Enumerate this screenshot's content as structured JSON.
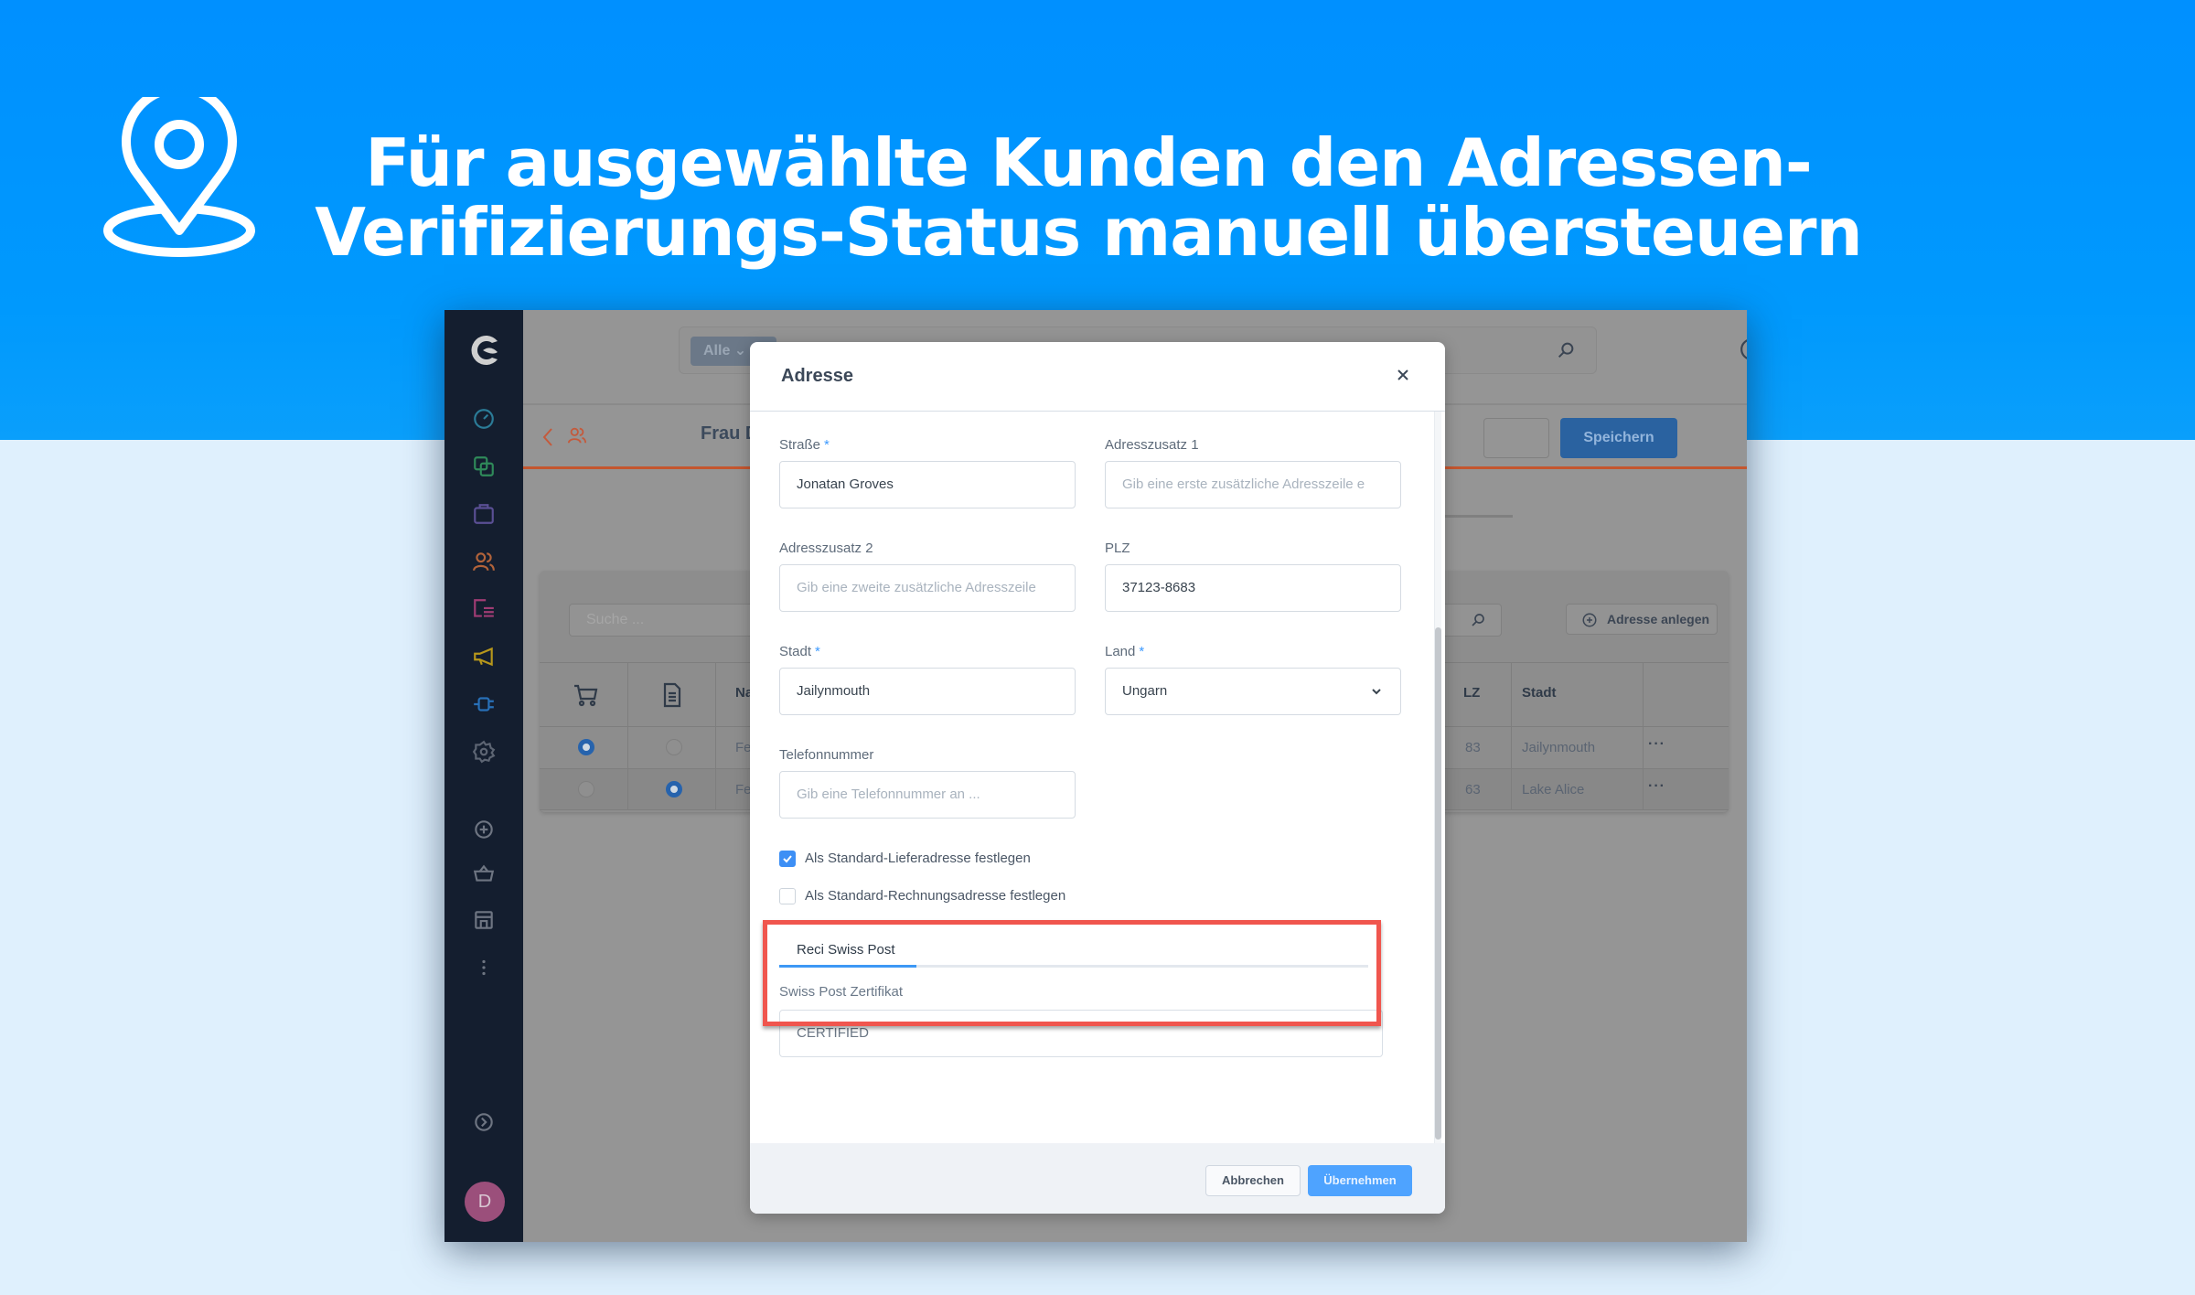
{
  "hero": {
    "title_line1": "Für ausgewählte Kunden den Adressen-",
    "title_line2": "Verifizierungs-Status manuell übersteuern",
    "icon": "location-pin-icon",
    "band_color": "#0093ff"
  },
  "app": {
    "logo": "shopware-logo",
    "sidebar": {
      "items": [
        {
          "icon": "dashboard-gauge-icon",
          "color": "#2b7c98"
        },
        {
          "icon": "catalog-layers-icon",
          "color": "#2f8a5a"
        },
        {
          "icon": "orders-bag-icon",
          "color": "#5a4f94"
        },
        {
          "icon": "customers-icon",
          "color": "#b2633a"
        },
        {
          "icon": "content-icon",
          "color": "#a03c74"
        },
        {
          "icon": "marketing-megaphone-icon",
          "color": "#b7971b"
        },
        {
          "icon": "extensions-plug-icon",
          "color": "#2870b8"
        },
        {
          "icon": "settings-gear-icon",
          "color": "#5d6573"
        }
      ],
      "bottom_items": [
        {
          "icon": "add-circle-icon"
        },
        {
          "icon": "basket-icon"
        },
        {
          "icon": "storefront-icon"
        },
        {
          "icon": "more-vertical-icon"
        }
      ],
      "expand_icon": "expand-chevron-icon",
      "avatar_initial": "D"
    },
    "topbar": {
      "search_scope": "Alle",
      "search_placeholder": ""
    },
    "pagehead": {
      "customer_name": "Frau Dr. r",
      "save_label": "Speichern"
    },
    "addresses": {
      "search_placeholder": "Suche ...",
      "add_label": "Adresse anlegen",
      "columns": [
        "",
        "",
        "Na",
        "LZ",
        "Stadt",
        ""
      ],
      "rows": [
        {
          "shipping_default": true,
          "billing_default": false,
          "name": "Fe",
          "zip": "83",
          "city": "Jailynmouth",
          "actions": "···"
        },
        {
          "shipping_default": false,
          "billing_default": true,
          "name": "Fe",
          "zip": "63",
          "city": "Lake Alice",
          "actions": "···"
        }
      ]
    }
  },
  "modal": {
    "title": "Adresse",
    "fields": {
      "street": {
        "label": "Straße",
        "required": "*",
        "value": "Jonatan Groves"
      },
      "addr1": {
        "label": "Adresszusatz 1",
        "placeholder": "Gib eine erste zusätzliche Adresszeile e"
      },
      "addr2": {
        "label": "Adresszusatz 2",
        "placeholder": "Gib eine zweite zusätzliche Adresszeile"
      },
      "zip": {
        "label": "PLZ",
        "value": "37123-8683"
      },
      "city": {
        "label": "Stadt",
        "required": "*",
        "value": "Jailynmouth"
      },
      "country": {
        "label": "Land",
        "required": "*",
        "value": "Ungarn"
      },
      "phone": {
        "label": "Telefonnummer",
        "placeholder": "Gib eine Telefonnummer an ..."
      }
    },
    "checkboxes": [
      {
        "label": "Als Standard-Lieferadresse festlegen",
        "checked": true
      },
      {
        "label": "Als Standard-Rechnungsadresse festlegen",
        "checked": false
      }
    ],
    "swiss_post": {
      "tab_label": "Reci Swiss Post",
      "field_label": "Swiss Post Zertifikat",
      "value": "CERTIFIED",
      "highlight_color": "#f0564e"
    },
    "footer": {
      "cancel_label": "Abbrechen",
      "apply_label": "Übernehmen"
    }
  }
}
